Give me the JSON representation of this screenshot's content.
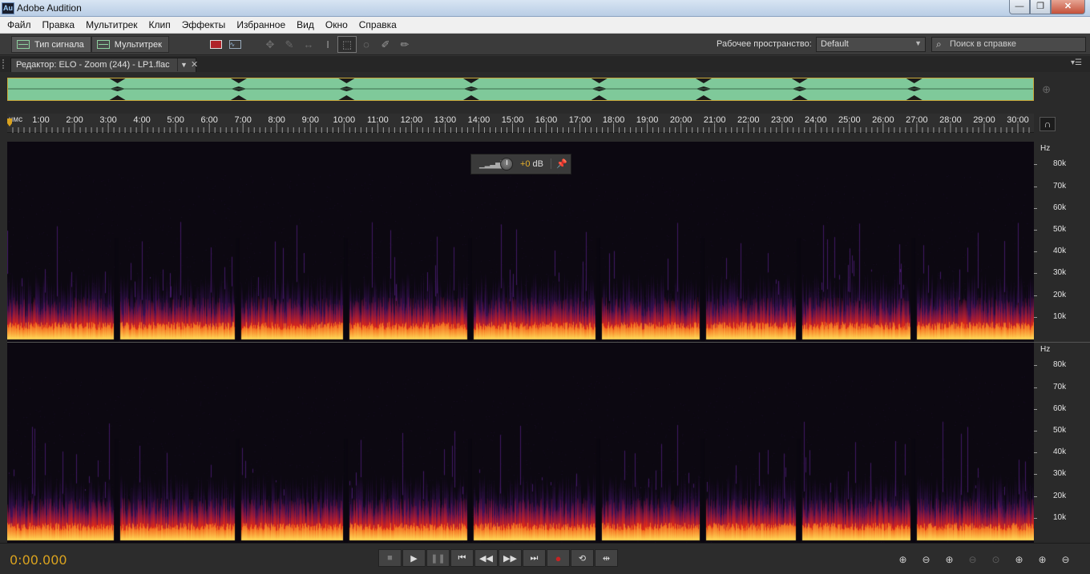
{
  "window": {
    "title": "Adobe Audition",
    "app_icon": "Au"
  },
  "menu": [
    "Файл",
    "Правка",
    "Мультитрек",
    "Клип",
    "Эффекты",
    "Избранное",
    "Вид",
    "Окно",
    "Справка"
  ],
  "toolbar": {
    "waveform_label": "Тип сигнала",
    "multitrack_label": "Мультитрек",
    "workspace_label": "Рабочее пространство:",
    "workspace_value": "Default",
    "help_search_placeholder": "Поиск в справке"
  },
  "document": {
    "tab_label": "Редактор: ELO - Zoom (244) - LP1.flac"
  },
  "ruler": {
    "unit_label": "чмс",
    "labels": [
      "1:00",
      "2:00",
      "3:00",
      "4:00",
      "5:00",
      "6:00",
      "7:00",
      "8:00",
      "9:00",
      "10:00",
      "11:00",
      "12:00",
      "13:00",
      "14:00",
      "15:00",
      "16:00",
      "17:00",
      "18:00",
      "19:00",
      "20:00",
      "21:00",
      "22:00",
      "23:00",
      "24:00",
      "25:00",
      "26:00",
      "27:00",
      "28:00",
      "29:00",
      "30:00"
    ],
    "seconds_total": 1830
  },
  "spectral": {
    "hz_unit": "Hz",
    "hz_labels": [
      "80k",
      "70k",
      "60k",
      "50k",
      "40k",
      "30k",
      "20k",
      "10k"
    ],
    "track_gaps_min": [
      3.25,
      6.85,
      10.05,
      13.75,
      17.55,
      20.65,
      23.5,
      26.9
    ],
    "colors": {
      "background": "#0c0811",
      "low": "#3a1260",
      "mid": "#c8201e",
      "high": "#ffd24a"
    }
  },
  "hud": {
    "gain_value": "+0",
    "gain_unit": "dB"
  },
  "transport": {
    "timecode": "0:00.000"
  },
  "colors": {
    "accent_orange": "#d9a21f",
    "overview_green": "#7fc99a"
  }
}
